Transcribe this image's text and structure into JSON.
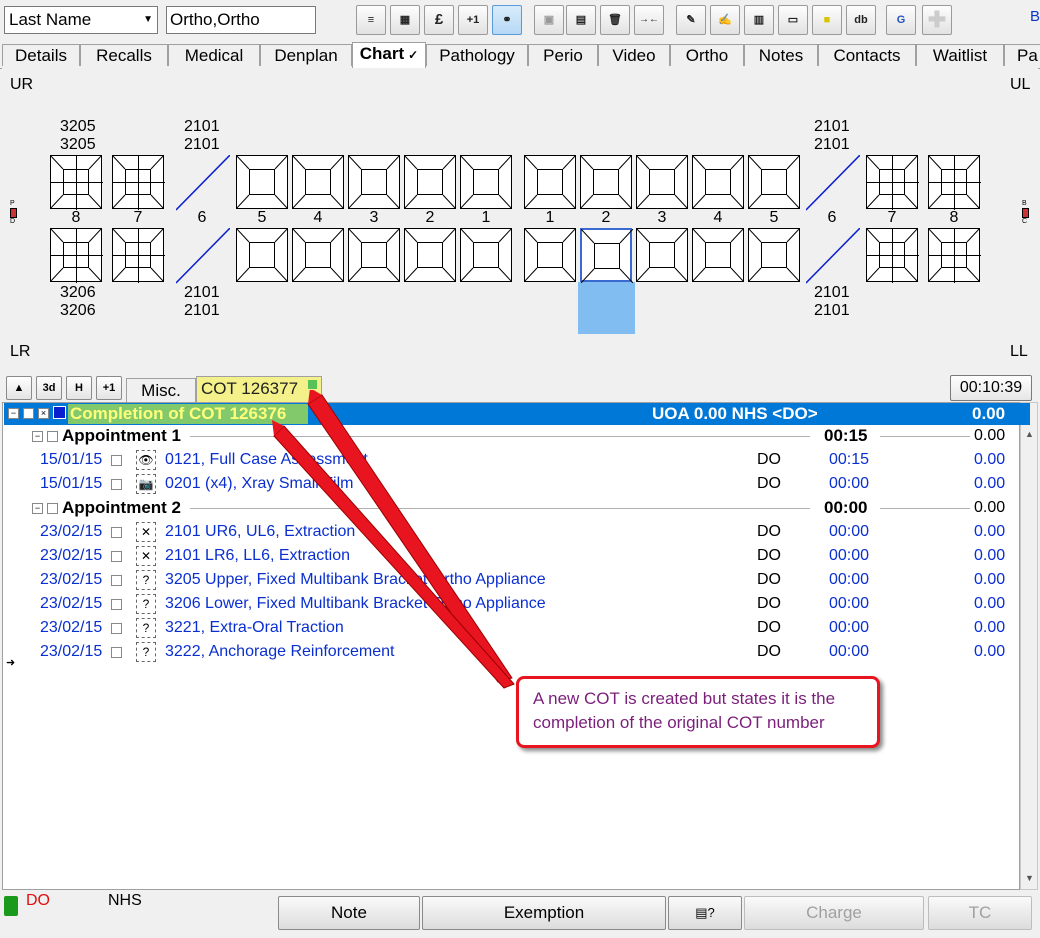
{
  "toolbar": {
    "search_field": "Last Name",
    "patient_name": "Ortho,Ortho",
    "icons": [
      "align-icon",
      "calendar-icon",
      "pound-icon",
      "plus-one-icon",
      "link-icon",
      "save-icon",
      "page-icon",
      "trash-icon",
      "merge-icon",
      "pen-icon",
      "pencil-doc-icon",
      "doc-disk-icon",
      "card-icon",
      "note-icon",
      "db-icon",
      "g-icon",
      "add-icon"
    ],
    "labels": {
      "pound": "£",
      "plus_one": "+1",
      "db": "db",
      "g": "G"
    },
    "right_text": "B"
  },
  "tabs": [
    "Details",
    "Recalls",
    "Medical",
    "Denplan",
    "Chart",
    "Pathology",
    "Perio",
    "Video",
    "Ortho",
    "Notes",
    "Contacts",
    "Waitlist",
    "Pa"
  ],
  "active_tab": "Chart",
  "chart": {
    "quadrants": {
      "ur": "UR",
      "ul": "UL",
      "lr": "LR",
      "ll": "LL"
    },
    "upper_numbers": [
      "8",
      "7",
      "6",
      "5",
      "4",
      "3",
      "2",
      "1",
      "1",
      "2",
      "3",
      "4",
      "5",
      "6",
      "7",
      "8"
    ],
    "upper_codes": {
      "ur8": [
        "3205",
        "3205"
      ],
      "ur6": [
        "2101",
        "2101"
      ],
      "ul6": [
        "2101",
        "2101"
      ]
    },
    "lower_codes": {
      "lr8": [
        "3206",
        "3206"
      ],
      "lr6": [
        "2101",
        "2101"
      ],
      "ll6": [
        "2101",
        "2101"
      ]
    },
    "side_left": [
      "P",
      "D"
    ],
    "side_right": [
      "B",
      "C"
    ]
  },
  "mid_toolbar": {
    "buttons": [
      "up-icon",
      "3d",
      "H",
      "+1"
    ],
    "misc_tab": "Misc.",
    "cot_tab": "COT 126377",
    "timer": "00:10:39"
  },
  "course": {
    "title": "Completion of COT 126376",
    "status": "UOA 0.00  NHS <DO>",
    "total": "0.00",
    "appointments": [
      {
        "label": "Appointment 1",
        "time": "00:15",
        "cost": "0.00",
        "items": [
          {
            "date": "15/01/15",
            "icon": "eye-icon",
            "text": "0121, Full Case Assessment",
            "who": "DO",
            "time": "00:15",
            "cost": "0.00"
          },
          {
            "date": "15/01/15",
            "icon": "camera-icon",
            "text": "0201 (x4), Xray Small Film",
            "who": "DO",
            "time": "00:00",
            "cost": "0.00"
          }
        ]
      },
      {
        "label": "Appointment 2",
        "time": "00:00",
        "cost": "0.00",
        "items": [
          {
            "date": "23/02/15",
            "icon": "extraction-icon",
            "text": "2101  UR6,  UL6, Extraction",
            "who": "DO",
            "time": "00:00",
            "cost": "0.00"
          },
          {
            "date": "23/02/15",
            "icon": "extraction-icon",
            "text": "2101  LR6,  LL6, Extraction",
            "who": "DO",
            "time": "00:00",
            "cost": "0.00"
          },
          {
            "date": "23/02/15",
            "icon": "question-icon",
            "text": "3205  Upper, Fixed Multibank Bracket Ortho Appliance",
            "who": "DO",
            "time": "00:00",
            "cost": "0.00"
          },
          {
            "date": "23/02/15",
            "icon": "question-icon",
            "text": "3206  Lower, Fixed Multibank Bracket Ortho Appliance",
            "who": "DO",
            "time": "00:00",
            "cost": "0.00"
          },
          {
            "date": "23/02/15",
            "icon": "question-icon",
            "text": "3221, Extra-Oral Traction",
            "who": "DO",
            "time": "00:00",
            "cost": "0.00"
          },
          {
            "date": "23/02/15",
            "icon": "question-icon",
            "text": "3222, Anchorage Reinforcement",
            "who": "DO",
            "time": "00:00",
            "cost": "0.00"
          }
        ]
      }
    ]
  },
  "callout": "A new COT is created but states it is the completion of the original COT number",
  "footer": {
    "dentist": "DO",
    "scheme": "NHS",
    "buttons": {
      "note": "Note",
      "exemption": "Exemption",
      "charge": "Charge",
      "tc": "TC"
    }
  },
  "colors": {
    "accent": "#0078d7",
    "highlight_green": "#82c96b",
    "cot_yellow": "#f4f08a",
    "callout_red": "#e8141f"
  }
}
